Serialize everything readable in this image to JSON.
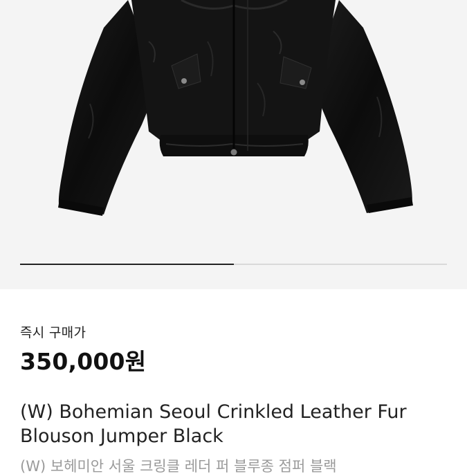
{
  "carousel": {
    "progress": 0.5
  },
  "product": {
    "price_label": "즉시 구매가",
    "price": "350,000원",
    "title_en": "(W) Bohemian Seoul Crinkled Leather Fur Blouson Jumper Black",
    "title_ko": "(W) 보헤미안 서울 크링클 레더 퍼 블루종 점퍼 블랙"
  },
  "image": {
    "subject": "black leather blouson jacket",
    "background": "#f4f4f4"
  },
  "colors": {
    "jacket": "#111111",
    "text_primary": "#222222",
    "text_secondary": "#9a9a9a"
  }
}
